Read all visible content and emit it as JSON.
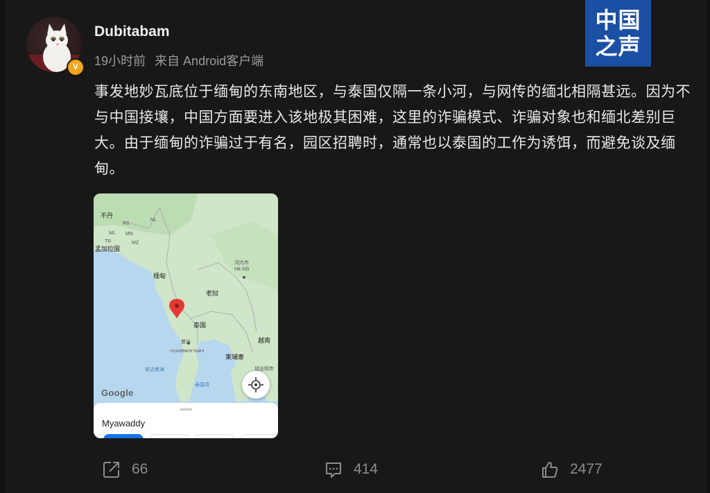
{
  "user": {
    "name": "Dubitabam",
    "time": "19小时前",
    "source": "来自 Android客户端",
    "badge": "V"
  },
  "logo": {
    "line1": "中国",
    "line2": "之声"
  },
  "post": {
    "text": "事发地妙瓦底位于缅甸的东南地区，与泰国仅隔一条小河，与网传的缅北相隔甚远。因为不与中国接壤，中国方面要进入该地极其困难，这里的诈骗模式、诈骗对象也和缅北差别巨大。由于缅甸的诈骗过于有名，园区招聘时，通常也以泰国的工作为诱饵，而避免谈及缅甸。"
  },
  "map": {
    "labels": {
      "bhutan": "不丹",
      "assam": "AS",
      "bangladesh": "孟加拉国",
      "myanmar": "缅甸",
      "laos": "老挝",
      "thailand": "泰国",
      "bangkok": "曼谷",
      "bangkok_thai": "กรุงเทพมหานคร",
      "cambodia": "柬埔寨",
      "vietnam": "越南",
      "hanoi": "河内市",
      "hanoi_vn": "Hà Nội",
      "hcmc": "胡志明市",
      "andaman": "安达曼海",
      "gulf": "泰国湾",
      "ml": "ML",
      "tr": "TR",
      "mn": "MN",
      "mz": "MZ",
      "nl": "NL"
    },
    "google": "Google",
    "place_name": "Myawaddy",
    "colors": {
      "land": "#cfe6c8",
      "water": "#b6d7ee",
      "pin": "#e53935"
    }
  },
  "actions": {
    "share": "66",
    "comment": "414",
    "like": "2477"
  }
}
